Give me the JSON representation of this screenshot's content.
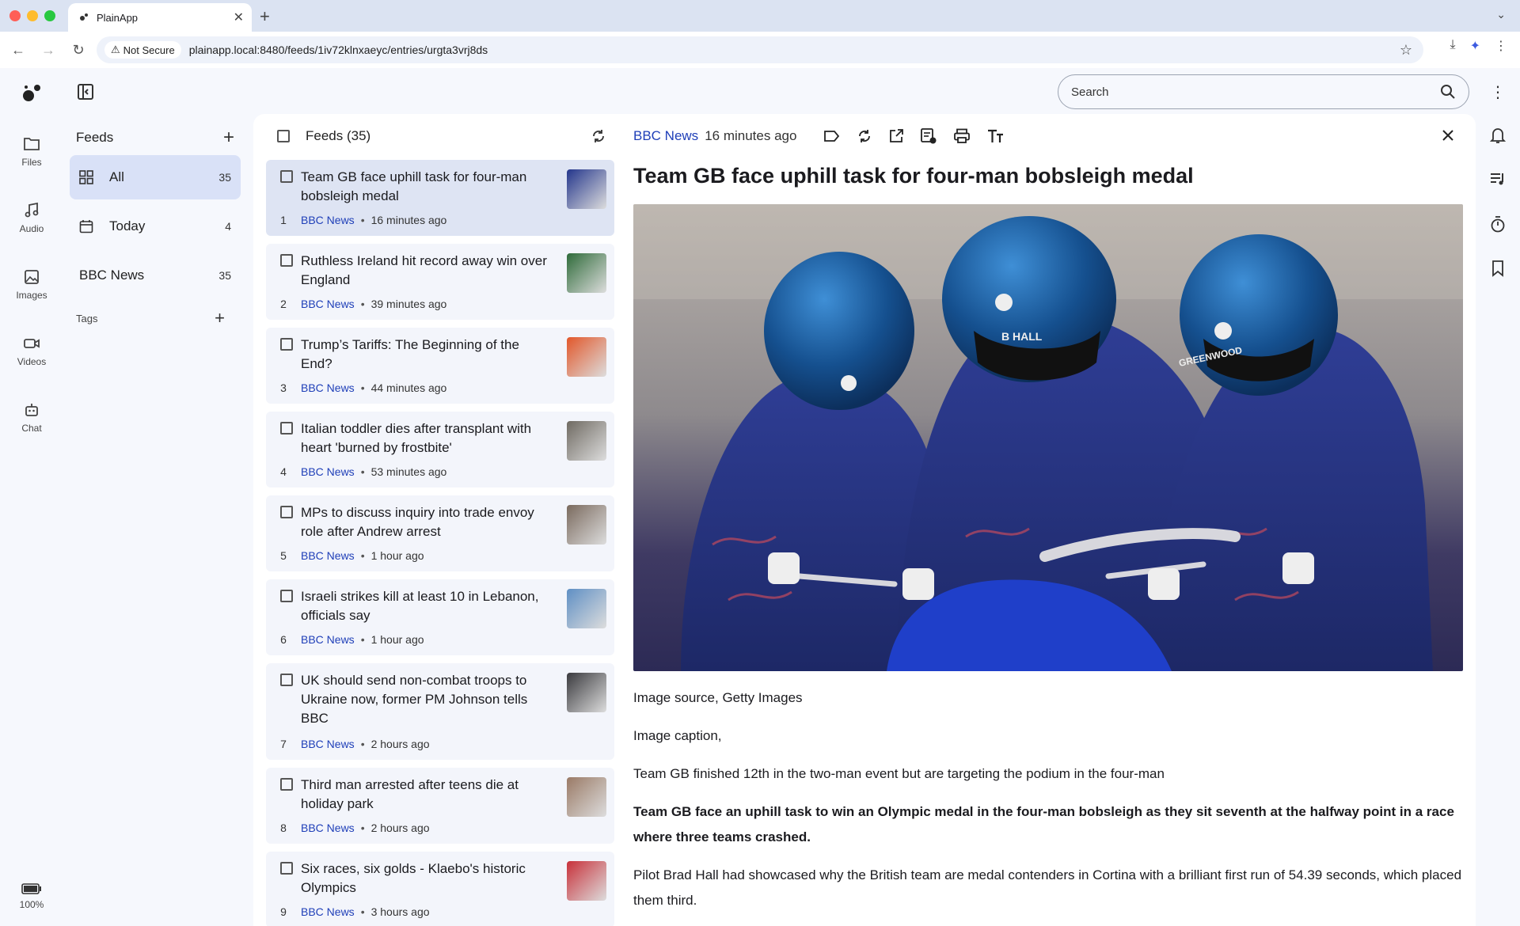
{
  "browser": {
    "tab_title": "PlainApp",
    "security_label": "Not Secure",
    "url": "plainapp.local:8480/feeds/1iv72klnxaeyc/entries/urgta3vrj8ds"
  },
  "rail": {
    "items": [
      {
        "label": "Files",
        "icon": "folder-icon"
      },
      {
        "label": "Audio",
        "icon": "music-note-icon"
      },
      {
        "label": "Images",
        "icon": "image-icon"
      },
      {
        "label": "Videos",
        "icon": "video-camera-icon"
      },
      {
        "label": "Chat",
        "icon": "robot-icon"
      }
    ],
    "battery": "100%"
  },
  "search": {
    "placeholder": "Search"
  },
  "sidebar": {
    "feeds_title": "Feeds",
    "items": [
      {
        "label": "All",
        "count": "35",
        "icon": "grid-icon"
      },
      {
        "label": "Today",
        "count": "4",
        "icon": "calendar-icon"
      },
      {
        "label": "BBC News",
        "count": "35"
      }
    ],
    "tags_title": "Tags"
  },
  "feedlist": {
    "header": "Feeds (35)",
    "entries": [
      {
        "num": "1",
        "title": "Team GB face uphill task for four-man bobsleigh medal",
        "source": "BBC News",
        "time": "16 minutes ago",
        "thumb_color": "#24368c"
      },
      {
        "num": "2",
        "title": "Ruthless Ireland hit record away win over England",
        "source": "BBC News",
        "time": "39 minutes ago",
        "thumb_color": "#2f6b3a"
      },
      {
        "num": "3",
        "title": "Trump’s Tariffs: The Beginning of the End?",
        "source": "BBC News",
        "time": "44 minutes ago",
        "thumb_color": "#e2572a"
      },
      {
        "num": "4",
        "title": "Italian toddler dies after transplant with heart 'burned by frostbite'",
        "source": "BBC News",
        "time": "53 minutes ago",
        "thumb_color": "#6f6a62"
      },
      {
        "num": "5",
        "title": "MPs to discuss inquiry into trade envoy role after Andrew arrest",
        "source": "BBC News",
        "time": "1 hour ago",
        "thumb_color": "#7a6a5e"
      },
      {
        "num": "6",
        "title": "Israeli strikes kill at least 10 in Lebanon, officials say",
        "source": "BBC News",
        "time": "1 hour ago",
        "thumb_color": "#5f8fc4"
      },
      {
        "num": "7",
        "title": "UK should send non-combat troops to Ukraine now, former PM Johnson tells BBC",
        "source": "BBC News",
        "time": "2 hours ago",
        "thumb_color": "#3a3a3e"
      },
      {
        "num": "8",
        "title": "Third man arrested after teens die at holiday park",
        "source": "BBC News",
        "time": "2 hours ago",
        "thumb_color": "#9a7a66"
      },
      {
        "num": "9",
        "title": "Six races, six golds - Klaebo's historic Olympics",
        "source": "BBC News",
        "time": "3 hours ago",
        "thumb_color": "#c8313a"
      }
    ]
  },
  "reader": {
    "source": "BBC News",
    "time": "16 minutes ago",
    "title": "Team GB face uphill task for four-man bobsleigh medal",
    "image_source": "Image source, Getty Images",
    "image_caption_label": "Image caption,",
    "caption": "Team GB finished 12th in the two-man event but are targeting the podium in the four-man",
    "lead": "Team GB face an uphill task to win an Olympic medal in the four-man bobsleigh as they sit seventh at the halfway point in a race where three teams crashed.",
    "para1": "Pilot Brad Hall had showcased why the British team are medal contenders in Cortina with a brilliant first run of 54.39 seconds, which placed them third.",
    "helmet_names": [
      "B HALL",
      "GREENWOOD"
    ]
  },
  "colors": {
    "accent": "#1f3fb8",
    "selected": "#d9e1f7"
  }
}
